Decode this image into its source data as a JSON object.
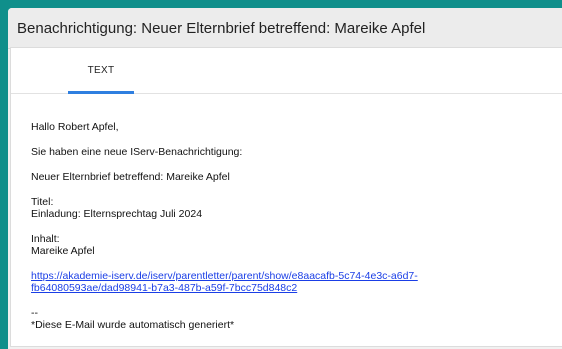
{
  "window": {
    "title": "Benachrichtigung: Neuer Elternbrief betreffend: Mareike Apfel"
  },
  "tabs": [
    {
      "label": "TEXT",
      "active": true
    }
  ],
  "message": {
    "greeting": "Hallo Robert Apfel,",
    "intro": "Sie haben eine neue IServ-Benachrichtigung:",
    "subject": "Neuer Elternbrief betreffend: Mareike Apfel",
    "title_label": "Titel:",
    "title_value": "Einladung: Elternsprechtag Juli 2024",
    "content_label": "Inhalt:",
    "content_value": "Mareike Apfel",
    "link_line1": "https://akademie-iserv.de/iserv/parentletter/parent/show/e8aacafb-5c74-4e3c-a6d7-",
    "link_line2": "fb64080593ae/dad98941-b7a3-487b-a59f-7bcc75d848c2",
    "sig_separator": "--",
    "sig_text": "*Diese E-Mail wurde automatisch generiert*"
  },
  "colors": {
    "background": "#0f8f8b",
    "accent": "#2f7fe0",
    "link": "#1a3ee6"
  }
}
